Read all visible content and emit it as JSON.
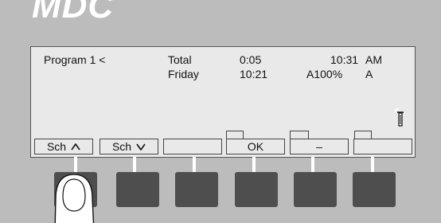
{
  "brand": {
    "logo_text": "MDC"
  },
  "lcd": {
    "row1": {
      "program": "Program  1 <",
      "total_label": "Total",
      "total_value": "0:05",
      "clock": "10:31",
      "ampm": "AM"
    },
    "row2": {
      "day": "Friday",
      "day_time": "10:21",
      "rate": "A100%",
      "mode": "A"
    }
  },
  "softkeys": {
    "key1": "Sch",
    "key2": "Sch",
    "key3": "",
    "key4": "OK",
    "key5": "–",
    "key6": ""
  },
  "icons": {
    "key1_glyph": "caret-up-icon",
    "key2_glyph": "caret-down-icon",
    "status_glyph": "thermometer-icon"
  }
}
